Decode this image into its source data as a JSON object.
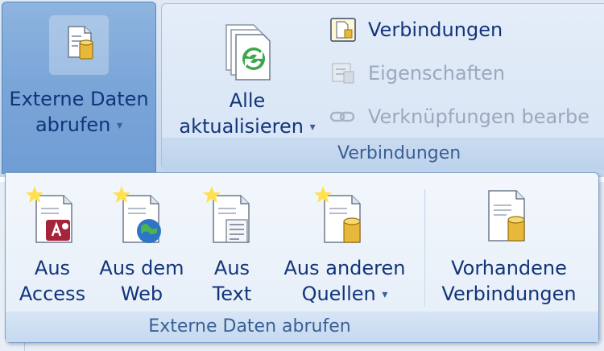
{
  "ribbon": {
    "externe_daten_button": {
      "label_line1": "Externe Daten",
      "label_line2": "abrufen",
      "icon": "database-document-icon"
    },
    "verbindungen_group": {
      "title": "Verbindungen",
      "alle_aktualisieren": {
        "label_line1": "Alle",
        "label_line2": "aktualisieren",
        "icon": "refresh-document-icon"
      },
      "items": [
        {
          "label": "Verbindungen",
          "icon": "connections-icon",
          "enabled": true
        },
        {
          "label": "Eigenschaften",
          "icon": "properties-icon",
          "enabled": false
        },
        {
          "label": "Verknüpfungen bearbe",
          "icon": "chain-link-icon",
          "enabled": false
        }
      ]
    }
  },
  "dropdown_panel": {
    "title": "Externe Daten abrufen",
    "buttons": [
      {
        "line1": "Aus",
        "line2": "Access",
        "icon": "access-document-icon"
      },
      {
        "line1": "Aus dem",
        "line2": "Web",
        "icon": "web-document-icon"
      },
      {
        "line1": "Aus",
        "line2": "Text",
        "icon": "text-document-icon"
      },
      {
        "line1": "Aus anderen",
        "line2": "Quellen",
        "icon": "database-document-icon"
      },
      {
        "line1": "Vorhandene",
        "line2": "Verbindungen",
        "icon": "existing-connections-icon"
      }
    ]
  },
  "colors": {
    "text": "#12357a",
    "disabled_text": "#9aa9bd",
    "group_label": "#3b5f94",
    "pressed_button": "#7aa5d8"
  }
}
